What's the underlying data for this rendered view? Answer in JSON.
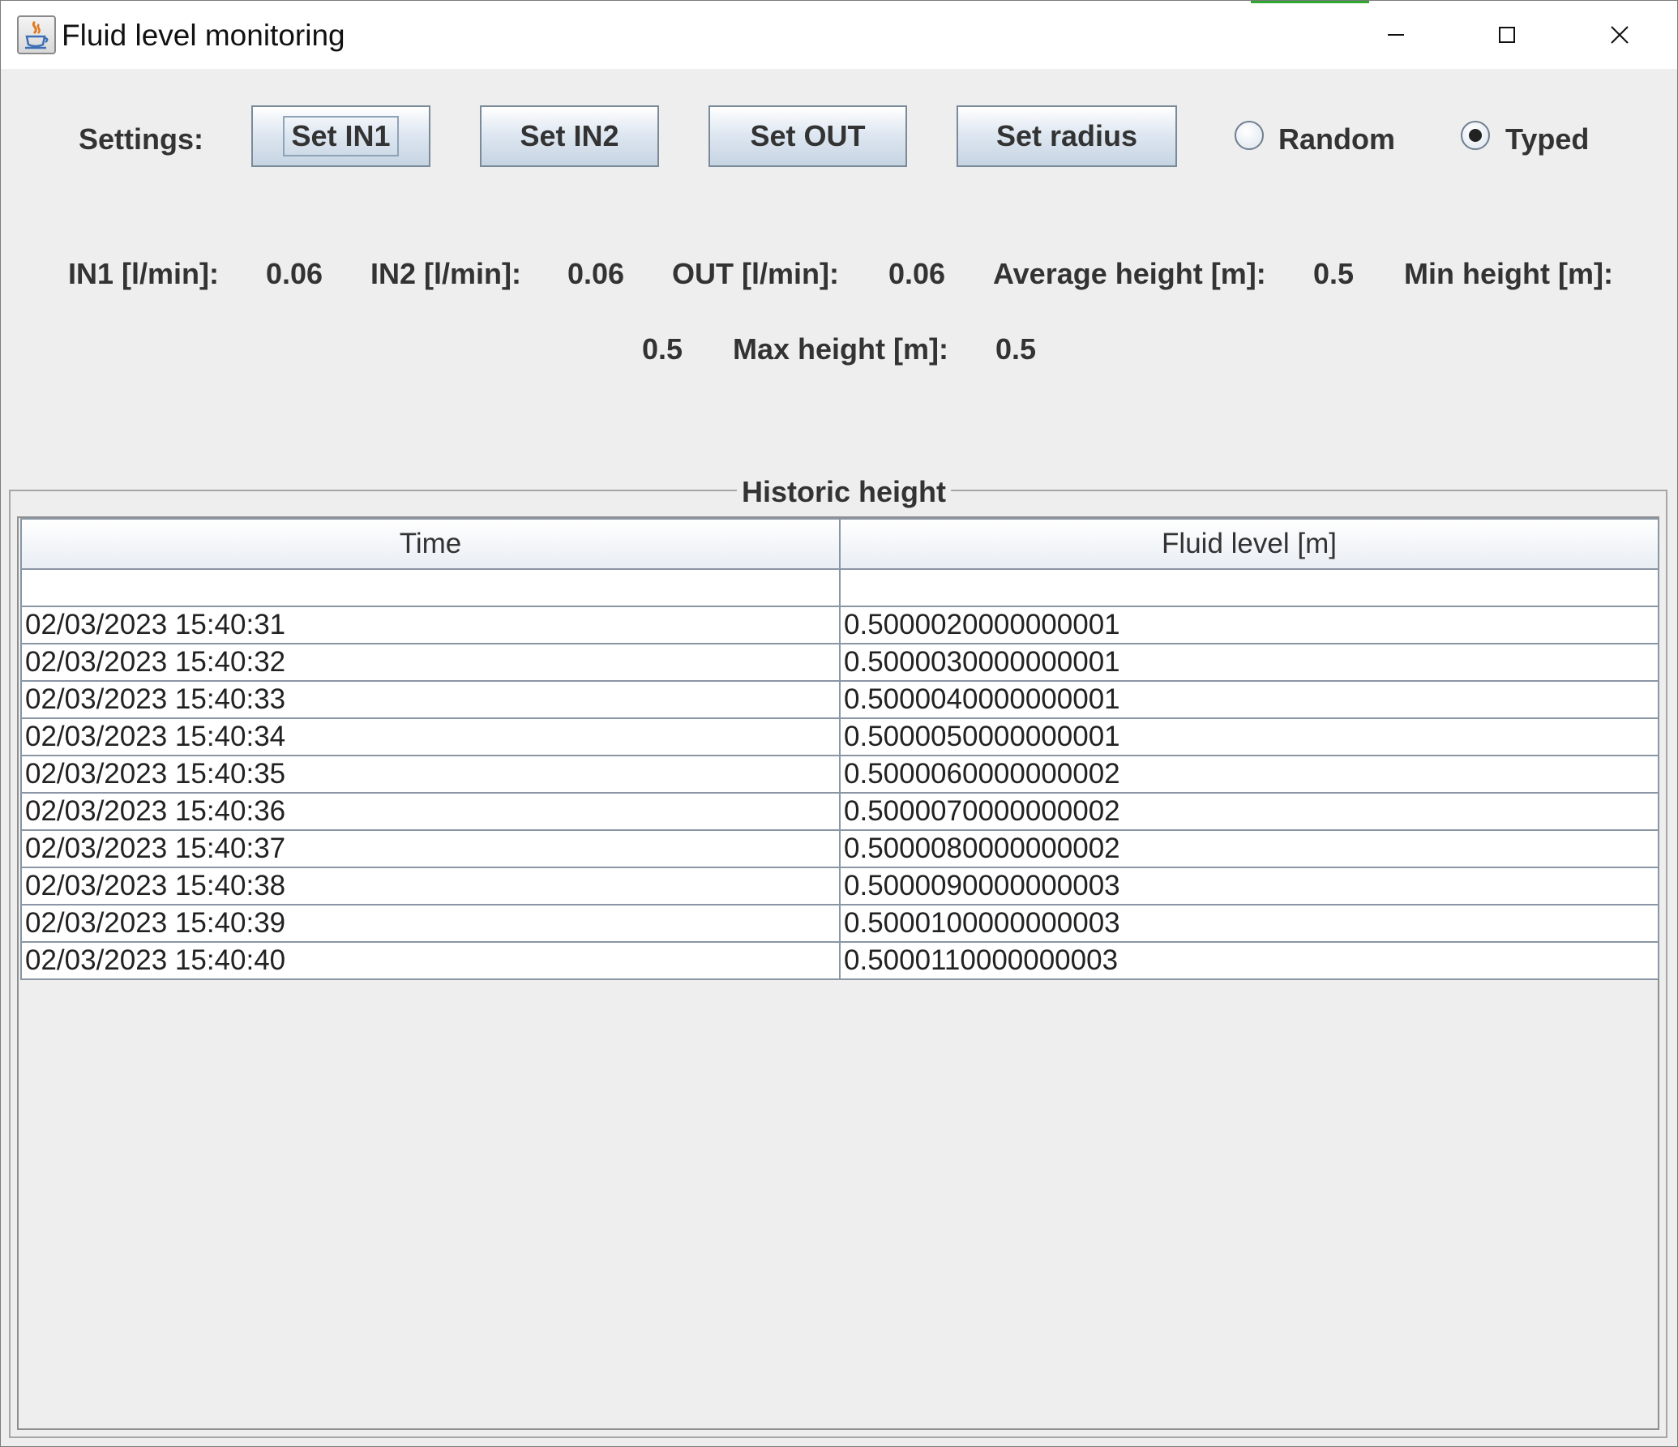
{
  "window": {
    "title": "Fluid level monitoring"
  },
  "settings": {
    "label": "Settings:",
    "buttons": [
      "Set IN1",
      "Set IN2",
      "Set OUT",
      "Set radius"
    ],
    "radio_options": [
      {
        "label": "Random",
        "selected": false
      },
      {
        "label": "Typed",
        "selected": true
      }
    ]
  },
  "stats": {
    "in1_label": "IN1 [l/min]:",
    "in1_value": "0.06",
    "in2_label": "IN2 [l/min]:",
    "in2_value": "0.06",
    "out_label": "OUT [l/min]:",
    "out_value": "0.06",
    "avg_label": "Average height [m]:",
    "avg_value": "0.5",
    "min_label": "Min height [m]:",
    "min_value": "0.5",
    "max_label": "Max height [m]:",
    "max_value": "0.5"
  },
  "history": {
    "title": "Historic height",
    "columns": [
      "Time",
      "Fluid level [m]"
    ],
    "rows": [
      [
        "",
        ""
      ],
      [
        "02/03/2023 15:40:31",
        "0.5000020000000001"
      ],
      [
        "02/03/2023 15:40:32",
        "0.5000030000000001"
      ],
      [
        "02/03/2023 15:40:33",
        "0.5000040000000001"
      ],
      [
        "02/03/2023 15:40:34",
        "0.5000050000000001"
      ],
      [
        "02/03/2023 15:40:35",
        "0.5000060000000002"
      ],
      [
        "02/03/2023 15:40:36",
        "0.5000070000000002"
      ],
      [
        "02/03/2023 15:40:37",
        "0.5000080000000002"
      ],
      [
        "02/03/2023 15:40:38",
        "0.5000090000000003"
      ],
      [
        "02/03/2023 15:40:39",
        "0.5000100000000003"
      ],
      [
        "02/03/2023 15:40:40",
        "0.5000110000000003"
      ]
    ]
  },
  "icons": {
    "app": "java-coffee-icon",
    "minimize": "minimize-icon",
    "maximize": "maximize-icon",
    "close": "close-icon"
  }
}
